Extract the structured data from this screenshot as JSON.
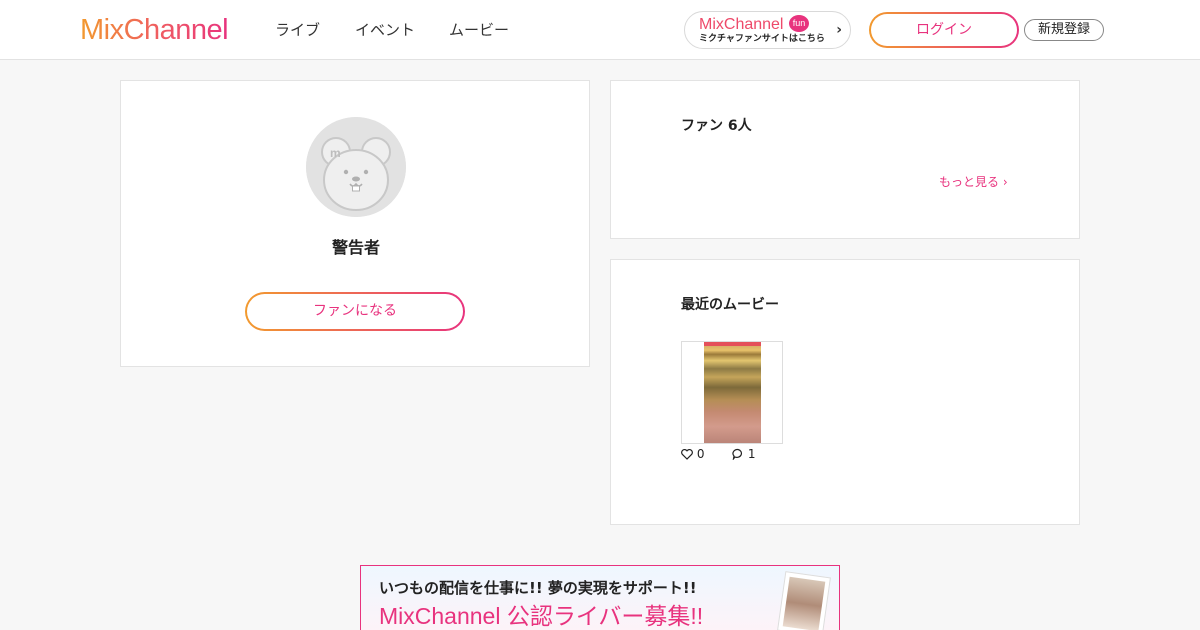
{
  "header": {
    "logo": "MixChannel",
    "nav": [
      {
        "label": "ライブ"
      },
      {
        "label": "イベント"
      },
      {
        "label": "ムービー"
      }
    ],
    "fan_site": {
      "logo": "MixChannel",
      "badge": "fun",
      "subtitle": "ミクチャファンサイトはこちら",
      "icon": "chevron-right-icon"
    },
    "login_label": "ログイン",
    "register_label": "新規登録"
  },
  "profile": {
    "avatar_icon": "bear-avatar-icon",
    "username": "警告者",
    "fan_button_label": "ファンになる"
  },
  "fans": {
    "title": "ファン 6人",
    "more_label": "もっと見る"
  },
  "movies": {
    "title": "最近のムービー",
    "items": [
      {
        "likes": "0",
        "comments": "1"
      }
    ]
  },
  "promo": {
    "line1": "いつもの配信を仕事に!! 夢の実現をサポート!!",
    "line2": "MixChannel 公認ライバー募集!!"
  },
  "colors": {
    "accent": "#e8337e",
    "accent_start": "#f29a2e",
    "background": "#f7f7f7"
  }
}
